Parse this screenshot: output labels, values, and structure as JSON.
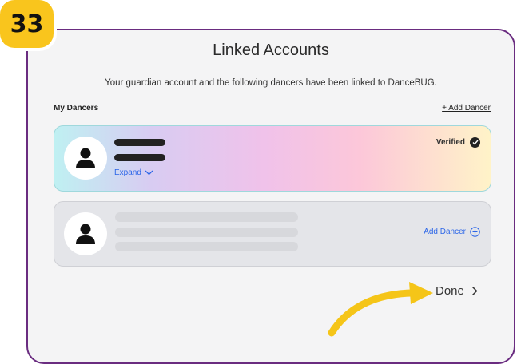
{
  "step_badge": "33",
  "title": "Linked Accounts",
  "subtitle": "Your guardian account and the following dancers have been linked to DanceBUG.",
  "section": {
    "label": "My Dancers",
    "add_link": "+ Add Dancer"
  },
  "linked_dancer": {
    "expand_label": "Expand",
    "status_label": "Verified",
    "status_icon": "check-circle-icon"
  },
  "empty_slot": {
    "add_label": "Add Dancer",
    "add_icon": "plus-circle-icon"
  },
  "done_label": "Done",
  "colors": {
    "frame": "#6a2c80",
    "badge": "#f9c51d",
    "link_blue": "#2c66e8",
    "arrow": "#f5c518"
  }
}
